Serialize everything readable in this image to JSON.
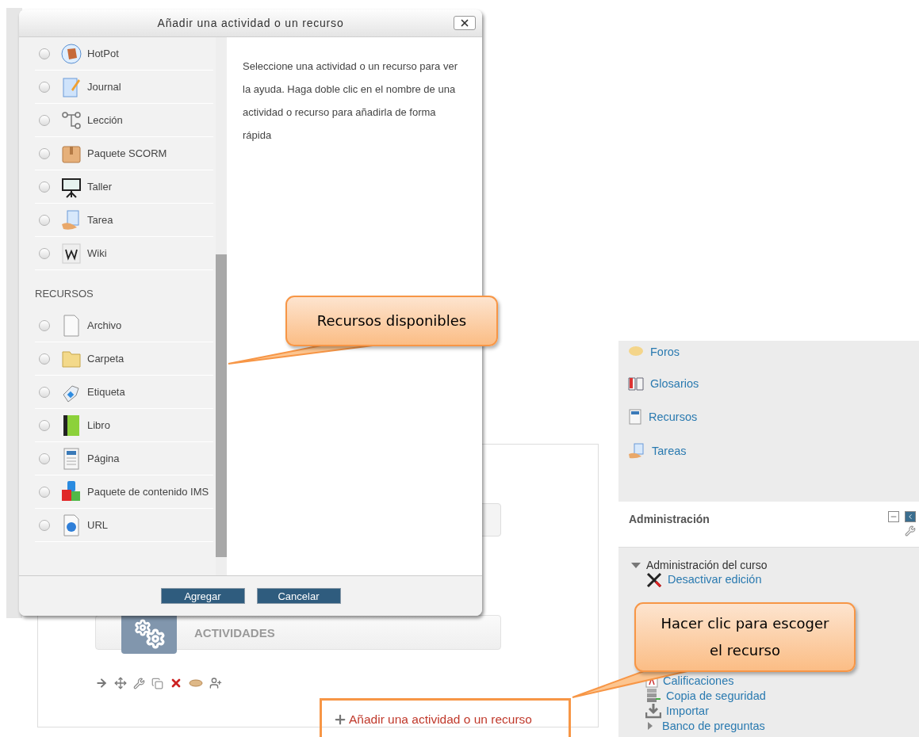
{
  "dialog": {
    "title": "Añadir una actividad o un recurso",
    "sections": [
      {
        "items": [
          {
            "label": "HotPot",
            "selected": false
          },
          {
            "label": "Journal",
            "selected": false
          },
          {
            "label": "Lección",
            "selected": false
          },
          {
            "label": "Paquete SCORM",
            "selected": false
          },
          {
            "label": "Taller",
            "selected": false
          },
          {
            "label": "Tarea",
            "selected": false
          },
          {
            "label": "Wiki",
            "selected": false
          }
        ]
      },
      {
        "heading": "RECURSOS",
        "items": [
          {
            "label": "Archivo",
            "selected": false
          },
          {
            "label": "Carpeta",
            "selected": false
          },
          {
            "label": "Etiqueta",
            "selected": false
          },
          {
            "label": "Libro",
            "selected": false
          },
          {
            "label": "Página",
            "selected": false
          },
          {
            "label": "Paquete de contenido IMS",
            "selected": false
          },
          {
            "label": "URL",
            "selected": false
          }
        ]
      }
    ],
    "help_text": "Seleccione una actividad o un recurso para ver la ayuda. Haga doble clic en el nombre de una actividad o recurso para añadirla de forma rápida",
    "buttons": [
      "Agregar",
      "Cancelar"
    ]
  },
  "sidebar": {
    "links": [
      "Foros",
      "Glosarios",
      "Recursos",
      "Tareas"
    ],
    "administration": {
      "title": "Administración",
      "tree": [
        {
          "label": "Administración del curso",
          "expanded": true,
          "children": [
            {
              "label": "Desactivar edición"
            },
            {
              "label": "Calificaciones"
            },
            {
              "label": "Copia de seguridad"
            },
            {
              "label": "Importar"
            },
            {
              "label": "Banco de preguntas",
              "expanded": false
            }
          ]
        }
      ]
    }
  },
  "section": {
    "title": "ACTIVIDADES",
    "add_link": "Añadir una actividad o un recurso"
  },
  "callouts": [
    {
      "text": "Recursos disponibles"
    },
    {
      "text": "Hacer clic para escoger el recurso"
    }
  ]
}
